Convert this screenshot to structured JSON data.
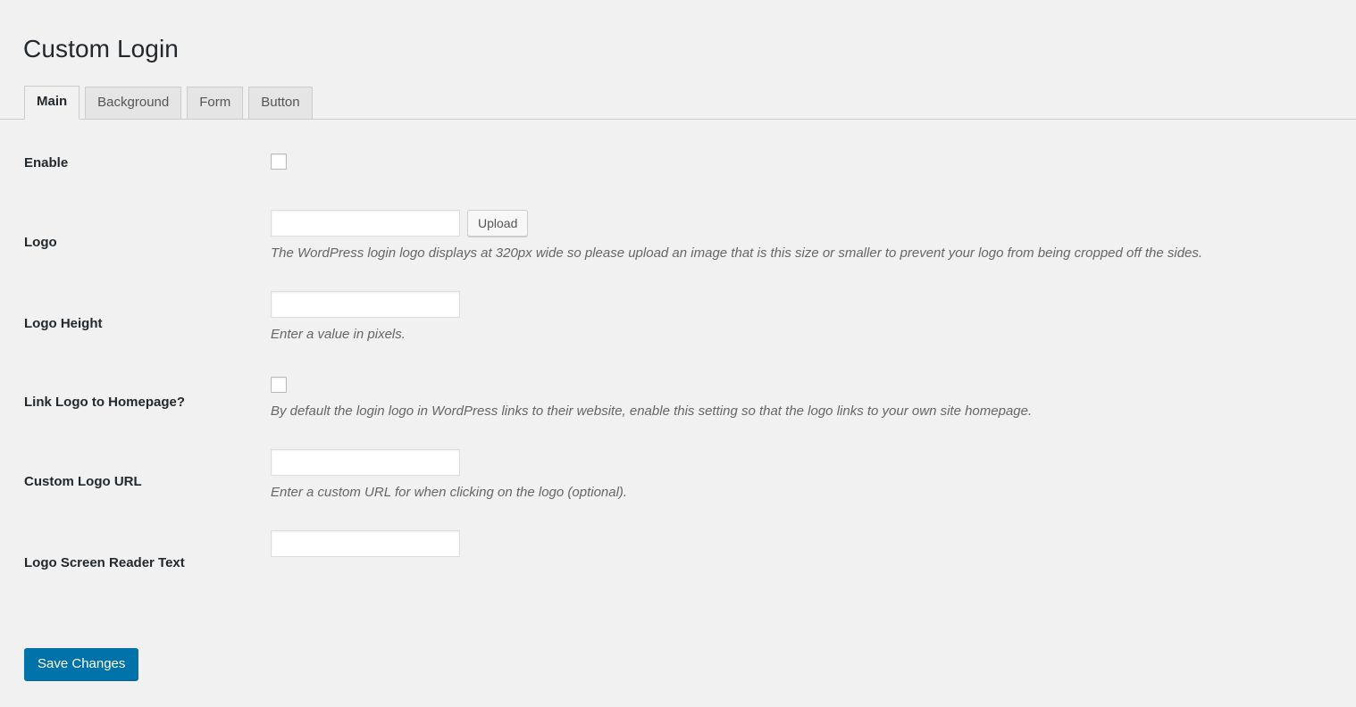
{
  "page": {
    "title": "Custom Login"
  },
  "tabs": [
    {
      "label": "Main",
      "active": true
    },
    {
      "label": "Background",
      "active": false
    },
    {
      "label": "Form",
      "active": false
    },
    {
      "label": "Button",
      "active": false
    }
  ],
  "fields": {
    "enable": {
      "label": "Enable",
      "checked": false
    },
    "logo": {
      "label": "Logo",
      "value": "",
      "placeholder": "",
      "upload_label": "Upload",
      "description": "The WordPress login logo displays at 320px wide so please upload an image that is this size or smaller to prevent your logo from being cropped off the sides."
    },
    "logo_height": {
      "label": "Logo Height",
      "value": "",
      "placeholder": "",
      "description": "Enter a value in pixels."
    },
    "link_logo_to_homepage": {
      "label": "Link Logo to Homepage?",
      "checked": false,
      "description": "By default the login logo in WordPress links to their website, enable this setting so that the logo links to your own site homepage."
    },
    "custom_logo_url": {
      "label": "Custom Logo URL",
      "value": "",
      "placeholder": "",
      "description": "Enter a custom URL for when clicking on the logo (optional)."
    },
    "logo_screen_reader_text": {
      "label": "Logo Screen Reader Text",
      "value": "",
      "placeholder": ""
    }
  },
  "submit": {
    "label": "Save Changes"
  },
  "colors": {
    "page_background": "#f1f1f1",
    "title_text": "#23282d",
    "primary_button": "#0073aa",
    "description_text": "#666666",
    "tab_inactive_background": "#e5e5e5",
    "border": "#cccccc"
  }
}
